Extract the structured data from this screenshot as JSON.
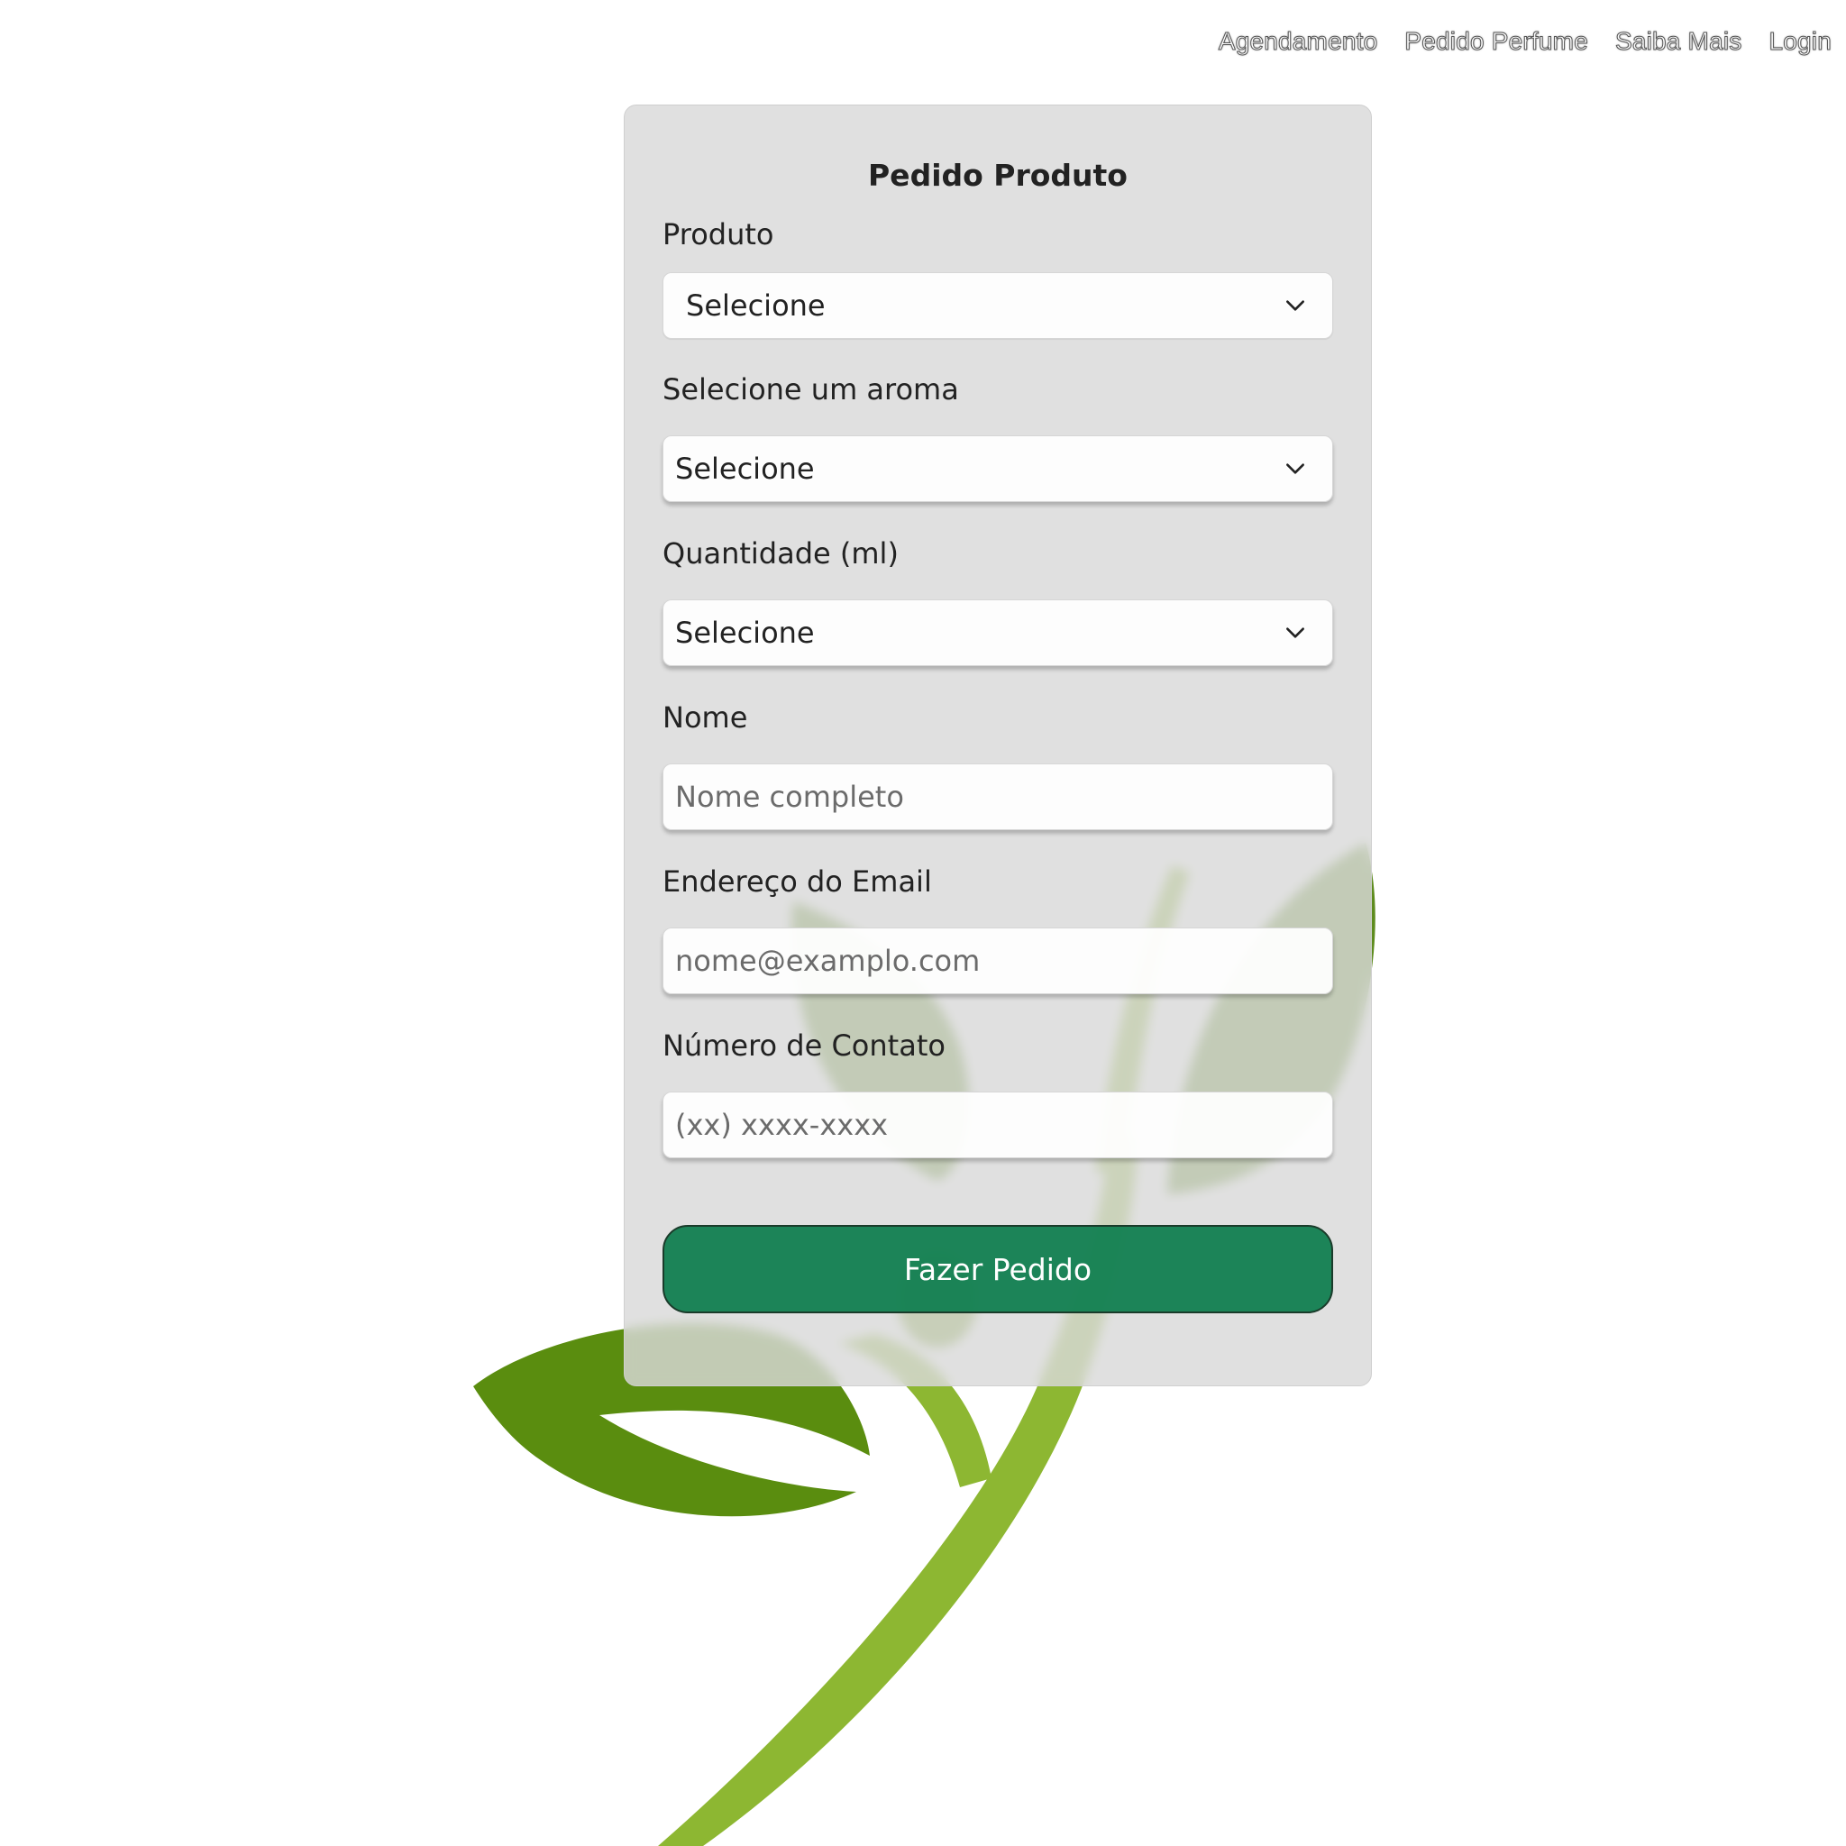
{
  "nav": {
    "items": [
      {
        "label": "Agendamento"
      },
      {
        "label": "Pedido Perfume"
      },
      {
        "label": "Saiba Mais"
      },
      {
        "label": "Login"
      }
    ]
  },
  "form": {
    "title": "Pedido Produto",
    "produto": {
      "label": "Produto",
      "value": "Selecione"
    },
    "aroma": {
      "label": "Selecione um aroma",
      "value": "Selecione"
    },
    "quantidade": {
      "label": "Quantidade (ml)",
      "value": "Selecione"
    },
    "nome": {
      "label": "Nome",
      "placeholder": "Nome completo",
      "value": ""
    },
    "email": {
      "label": "Endereço do Email",
      "placeholder": "nome@examplo.com",
      "value": ""
    },
    "contato": {
      "label": "Número de Contato",
      "placeholder": "(xx) xxxx-xxxx",
      "value": ""
    },
    "submit_label": "Fazer Pedido"
  },
  "colors": {
    "accent": "#148052",
    "leaf_dark": "#5a8a1a",
    "leaf_light": "#8db732",
    "card_bg": "#d9d9d9"
  },
  "icons": {
    "background_logo": "plant-sprout-icon",
    "select_indicator": "chevron-down-icon"
  }
}
